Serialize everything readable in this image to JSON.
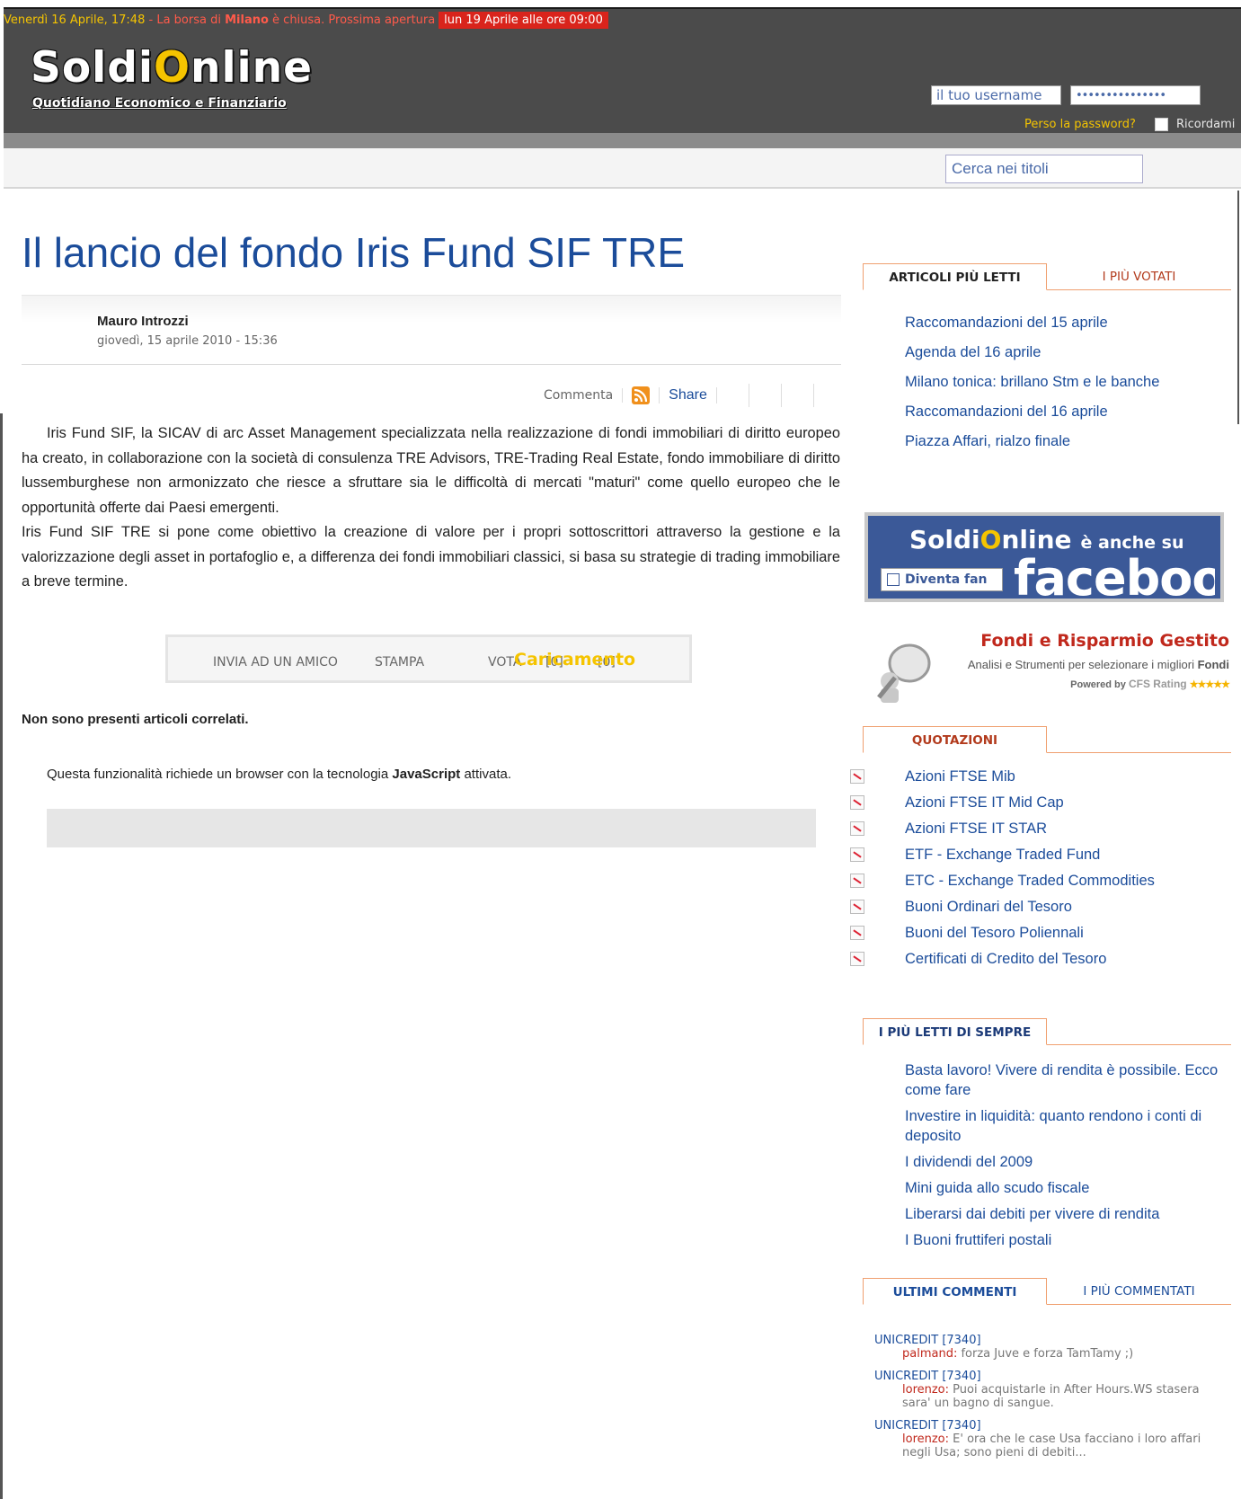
{
  "ticker": {
    "date": "Venerdì 16 Aprile, 17:48",
    "separator": " - ",
    "msg_prefix": "La borsa di ",
    "city": "Milano",
    "msg_suffix": " è chiusa. Prossima apertura",
    "next_open": "lun 19 Aprile alle ore 09:00"
  },
  "logo": {
    "name_left": "Soldi",
    "name_o": "O",
    "name_right": "nline",
    "tagline": "Quotidiano Economico e Finanziario"
  },
  "login": {
    "username_placeholder": "il tuo username",
    "password_mask": "•••••••••••••••",
    "lost_password": "Perso la password?",
    "remember_me": "Ricordami"
  },
  "search": {
    "placeholder": "Cerca nei titoli"
  },
  "article": {
    "title": "Il lancio del fondo Iris Fund SIF TRE",
    "author": "Mauro Introzzi",
    "date": "giovedì, 15 aprile 2010 - 15:36",
    "tools": {
      "comment": "Commenta",
      "share": "Share"
    },
    "paragraph_1": "Iris Fund SIF, la SICAV di arc Asset Management specializzata nella realizzazione di fondi immobiliari di diritto europeo ha creato, in collaborazione con la società di consulenza TRE Advisors, TRE-Trading Real Estate, fondo immobiliare di diritto lussemburghese non armonizzato che riesce a sfruttare sia le difficoltà di mercati \"maturi\" come quello europeo che le opportunità offerte dai Paesi emergenti.",
    "paragraph_2": "Iris Fund SIF TRE si pone come obiettivo la creazione di valore per i propri sottoscrittori attraverso la gestione e la valorizzazione degli asset in portafoglio e, a differenza dei fondi immobiliari classici, si basa su strategie di trading immobiliare a breve termine.",
    "actions": {
      "send": "INVIA AD UN AMICO",
      "print": "STAMPA",
      "vote": "VOTA",
      "count_a": "[0]",
      "count_b": "[0]",
      "loading": "Caricamento"
    },
    "no_related": "Non sono presenti articoli correlati.",
    "js_note_prefix": "Questa funzionalità richiede un browser con la tecnologia ",
    "js_note_bold": "JavaScript",
    "js_note_suffix": " attivata."
  },
  "sidebar": {
    "popular_tabs": {
      "active": "ARTICOLI PIÙ LETTI",
      "inactive": "I PIÙ VOTATI"
    },
    "popular": [
      "Raccomandazioni del 15 aprile",
      "Agenda del 16 aprile",
      "Milano tonica: brillano Stm e le banche",
      "Raccomandazioni del 16 aprile",
      "Piazza Affari, rialzo finale"
    ],
    "facebook": {
      "brand_left": "Soldi",
      "brand_o": "O",
      "brand_right": "nline",
      "also_on": "è anche su",
      "fan_button": "Diventa fan",
      "word": "facebook"
    },
    "funds": {
      "title": "Fondi e Risparmio Gestito",
      "subtitle": "Analisi e Strumenti per selezionare i migliori",
      "subtitle_bold": "Fondi",
      "powered_by": "Powered by",
      "cfs": "CFS Rating",
      "stars": "★★★★★"
    },
    "quotes_tab": "QUOTAZIONI",
    "quotes": [
      "Azioni FTSE Mib",
      "Azioni FTSE IT Mid Cap",
      "Azioni FTSE IT STAR",
      "ETF - Exchange Traded Fund",
      "ETC - Exchange Traded Commodities",
      "Buoni Ordinari del Tesoro",
      "Buoni del Tesoro Poliennali",
      "Certificati di Credito del Tesoro"
    ],
    "ever_tab": "I PIÙ LETTI DI SEMPRE",
    "ever": [
      "Basta lavoro! Vivere di rendita è possibile. Ecco come fare",
      "Investire in liquidità: quanto rendono i conti di deposito",
      "I dividendi del 2009",
      "Mini guida allo scudo fiscale",
      "Liberarsi dai debiti per vivere di rendita",
      "I Buoni fruttiferi postali"
    ],
    "comments_tabs": {
      "active": "ULTIMI COMMENTI",
      "inactive": "I PIÙ COMMENTATI"
    },
    "comments": [
      {
        "topic": "UNICREDIT  [7340]",
        "user": "palmand:",
        "text": "forza Juve e forza TamTamy ;)"
      },
      {
        "topic": "UNICREDIT  [7340]",
        "user": "lorenzo:",
        "text": "Puoi acquistarle in After Hours.WS stasera sara' un bagno di sangue."
      },
      {
        "topic": "UNICREDIT  [7340]",
        "user": "lorenzo:",
        "text": "E' ora che le case Usa facciano i loro affari negli Usa; sono pieni di debiti..."
      }
    ]
  },
  "colors": {
    "brand_blue": "#1b4c9a",
    "accent_yellow": "#f5c400",
    "accent_red": "#c0281c",
    "header_gray": "#4b4b4b"
  }
}
